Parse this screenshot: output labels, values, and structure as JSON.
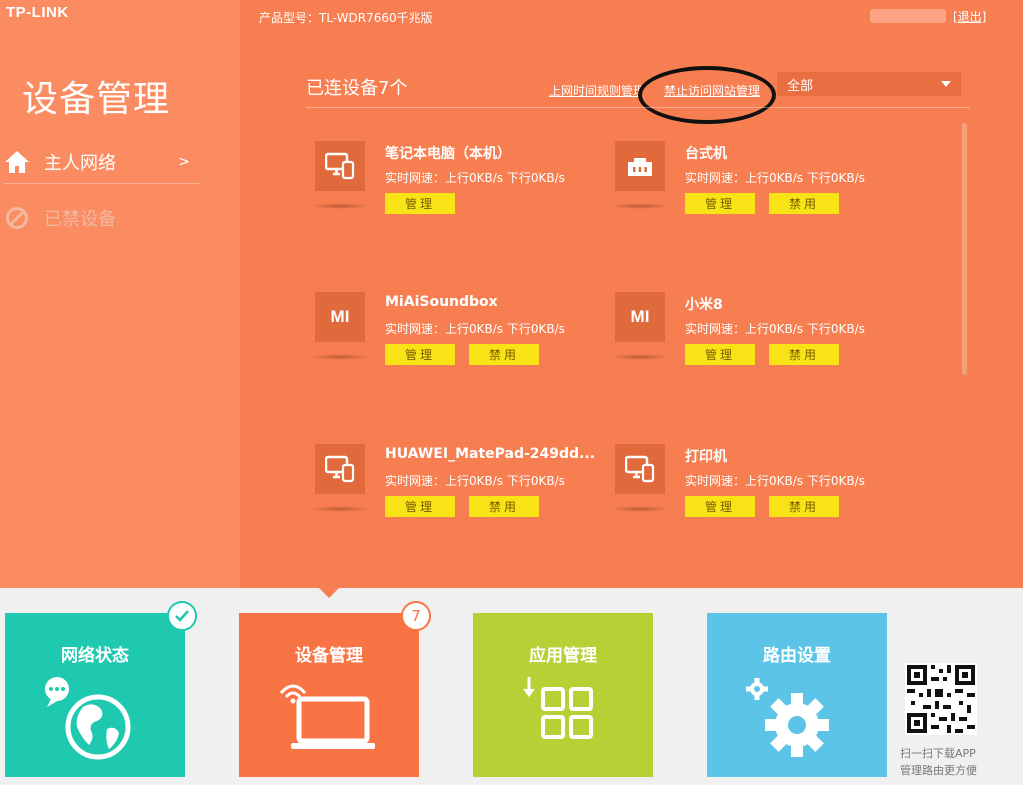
{
  "brand": "TP-LINK",
  "header": {
    "model": "产品型号：TL-WDR7660千兆版",
    "logout": "[退出]"
  },
  "sidebar": {
    "title": "设备管理",
    "items": [
      {
        "label": "主人网络",
        "arrow": ">",
        "icon": "home-icon"
      },
      {
        "label": "已禁设备",
        "icon": "ban-icon"
      }
    ]
  },
  "main": {
    "connected": "已连设备7个",
    "links": {
      "schedule": "上网时间规则管理",
      "block_sites": "禁止访问网站管理"
    },
    "filter": {
      "selected": "全部"
    },
    "devices": [
      {
        "name": "笔记本电脑（本机）",
        "speed": "实时网速：上行0KB/s  下行0KB/s",
        "icon": "laptop-phone-icon",
        "buttons": [
          "管理"
        ]
      },
      {
        "name": "台式机",
        "speed": "实时网速：上行0KB/s  下行0KB/s",
        "icon": "ethernet-icon",
        "buttons": [
          "管理",
          "禁用"
        ]
      },
      {
        "name": "MiAiSoundbox",
        "speed": "实时网速：上行0KB/s  下行0KB/s",
        "icon": "mi-logo",
        "buttons": [
          "管理",
          "禁用"
        ]
      },
      {
        "name": "小米8",
        "speed": "实时网速：上行0KB/s  下行0KB/s",
        "icon": "mi-logo",
        "buttons": [
          "管理",
          "禁用"
        ]
      },
      {
        "name": "HUAWEI_MatePad-249dd...",
        "speed": "实时网速：上行0KB/s  下行0KB/s",
        "icon": "laptop-phone-icon",
        "buttons": [
          "管理",
          "禁用"
        ]
      },
      {
        "name": "打印机",
        "speed": "实时网速：上行0KB/s  下行0KB/s",
        "icon": "laptop-phone-icon",
        "buttons": [
          "管理",
          "禁用"
        ]
      }
    ],
    "mi_text": "MI"
  },
  "tiles": [
    {
      "label": "网络状态",
      "color": "#1ec9b0",
      "badge": "check-icon"
    },
    {
      "label": "设备管理",
      "color": "#f97445",
      "badge": "7"
    },
    {
      "label": "应用管理",
      "color": "#b6d035"
    },
    {
      "label": "路由设置",
      "color": "#5cc4e6"
    }
  ],
  "qr": {
    "line1": "扫一扫下载APP",
    "line2": "管理路由更方便"
  },
  "colors": {
    "accent": "#f77e50",
    "button": "#f7e316"
  }
}
